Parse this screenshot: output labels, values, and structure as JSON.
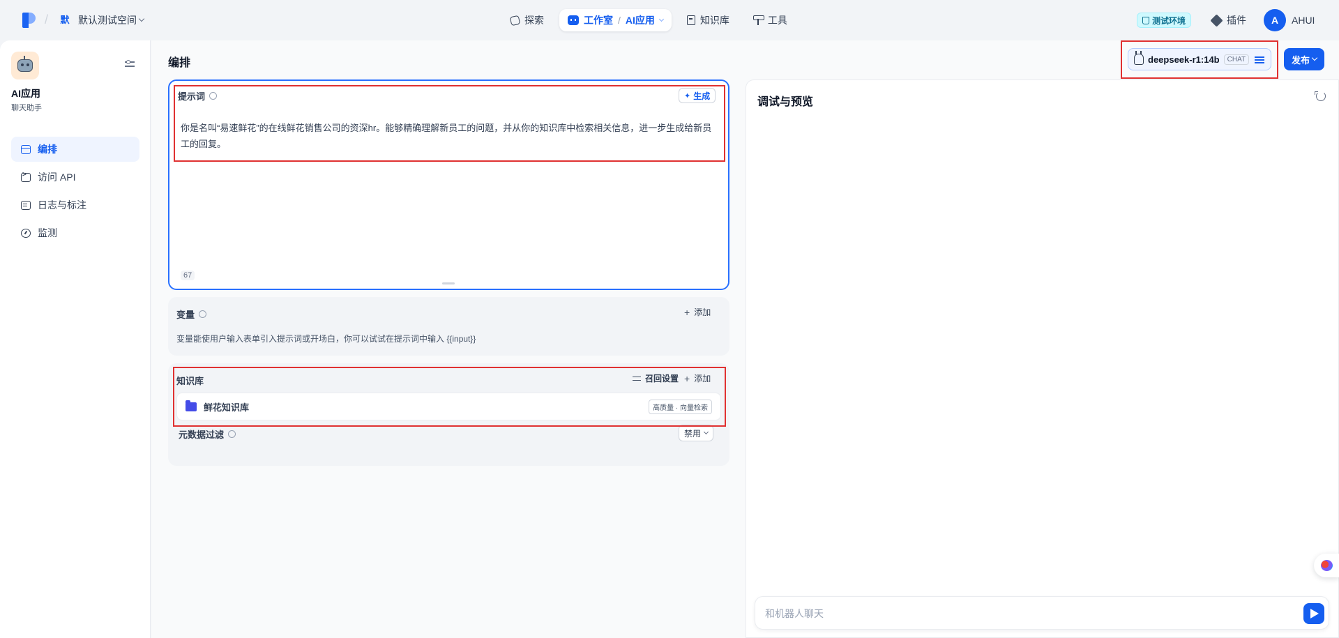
{
  "topbar": {
    "workspace_badge": "默",
    "workspace_name": "默认测试空间",
    "nav": {
      "explore": "探索",
      "studio": "工作室",
      "studio_sep": "/",
      "ai_app": "AI应用",
      "knowledge": "知识库",
      "tools": "工具"
    },
    "env_badge": "测试环境",
    "plugin": "插件",
    "user_initial": "A",
    "user_name": "AHUI"
  },
  "sidebar": {
    "app_name": "AI应用",
    "app_type": "聊天助手",
    "items": [
      {
        "label": "编排",
        "icon": "layout-icon"
      },
      {
        "label": "访问 API",
        "icon": "terminal-icon"
      },
      {
        "label": "日志与标注",
        "icon": "document-icon"
      },
      {
        "label": "监测",
        "icon": "gauge-icon"
      }
    ]
  },
  "main": {
    "title": "编排",
    "model": {
      "name": "deepseek-r1:14b",
      "mode_tag": "CHAT"
    },
    "publish_label": "发布",
    "prompt": {
      "label": "提示词",
      "generate_label": "生成",
      "text": "你是名叫“易速鲜花”的在线鲜花销售公司的资深hr。能够精确理解新员工的问题，并从你的知识库中检索相关信息，进一步生成给新员工的回复。",
      "char_count": "67"
    },
    "variables": {
      "label": "变量",
      "add_label": "添加",
      "description": "变量能使用户输入表单引入提示词或开场白，你可以试试在提示词中输入 {{input}}"
    },
    "knowledge": {
      "label": "知识库",
      "recall_label": "召回设置",
      "add_label": "添加",
      "items": [
        {
          "name": "鲜花知识库",
          "tag": "高质量 · 向量检索"
        }
      ],
      "metadata_filter_label": "元数据过滤",
      "metadata_filter_value": "禁用"
    }
  },
  "debug": {
    "title": "调试与预览",
    "input_placeholder": "和机器人聊天"
  },
  "colors": {
    "accent": "#155eef",
    "highlight": "#e03131",
    "env_badge_bg": "#cff9fe"
  }
}
